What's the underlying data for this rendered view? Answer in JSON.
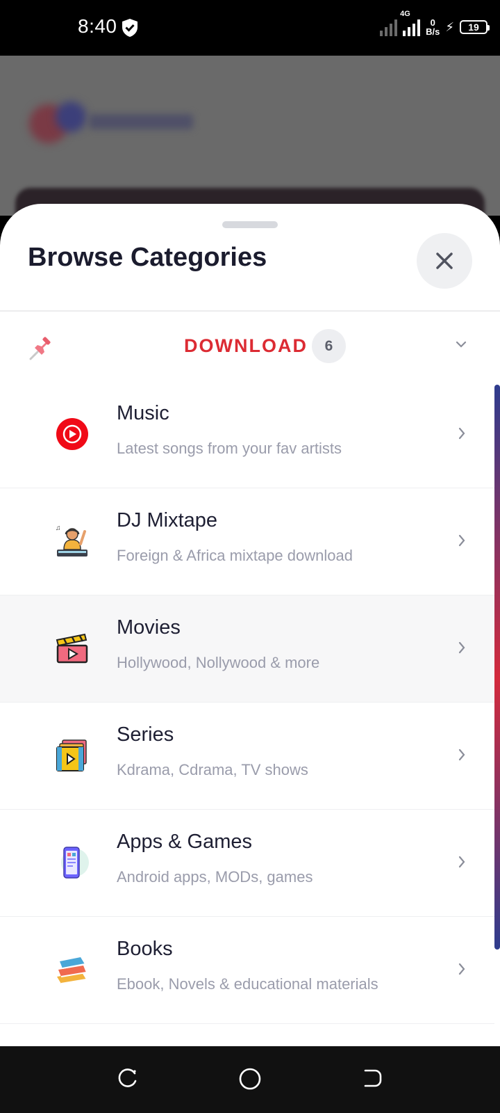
{
  "status_bar": {
    "time": "8:40",
    "network": "4G",
    "speed_value": "0",
    "speed_unit": "B/s",
    "battery": "19",
    "icons": [
      "shield-check-icon",
      "signal-weak-icon",
      "signal-4g-icon",
      "charging-bolt-icon",
      "battery-icon"
    ]
  },
  "sheet": {
    "title": "Browse Categories",
    "close_icon": "close-icon"
  },
  "section": {
    "icon": "pin-icon",
    "title": "DOWNLOAD",
    "count": "6",
    "toggle_icon": "chevron-down-icon"
  },
  "categories": [
    {
      "title": "Music",
      "subtitle": "Latest songs from your fav artists",
      "icon": "music-play-icon"
    },
    {
      "title": "DJ Mixtape",
      "subtitle": "Foreign & Africa mixtape download",
      "icon": "dj-icon"
    },
    {
      "title": "Movies",
      "subtitle": "Hollywood, Nollywood & more",
      "icon": "clapperboard-icon"
    },
    {
      "title": "Series",
      "subtitle": "Kdrama, Cdrama, TV shows",
      "icon": "film-reel-icon"
    },
    {
      "title": "Apps & Games",
      "subtitle": "Android apps, MODs, games",
      "icon": "phone-apps-icon"
    },
    {
      "title": "Books",
      "subtitle": "Ebook, Novels & educational materials",
      "icon": "books-icon"
    }
  ],
  "colors": {
    "section_accent": "#dc2b33",
    "title_text": "#1b1c2e",
    "subtitle_text": "#9a9cab",
    "music_red": "#f00a17",
    "scroll_blue": "#2e3c8e",
    "scroll_red": "#d32a3c"
  },
  "nav_bar": {
    "icons": [
      "recent-apps-icon",
      "home-icon",
      "back-icon"
    ]
  }
}
